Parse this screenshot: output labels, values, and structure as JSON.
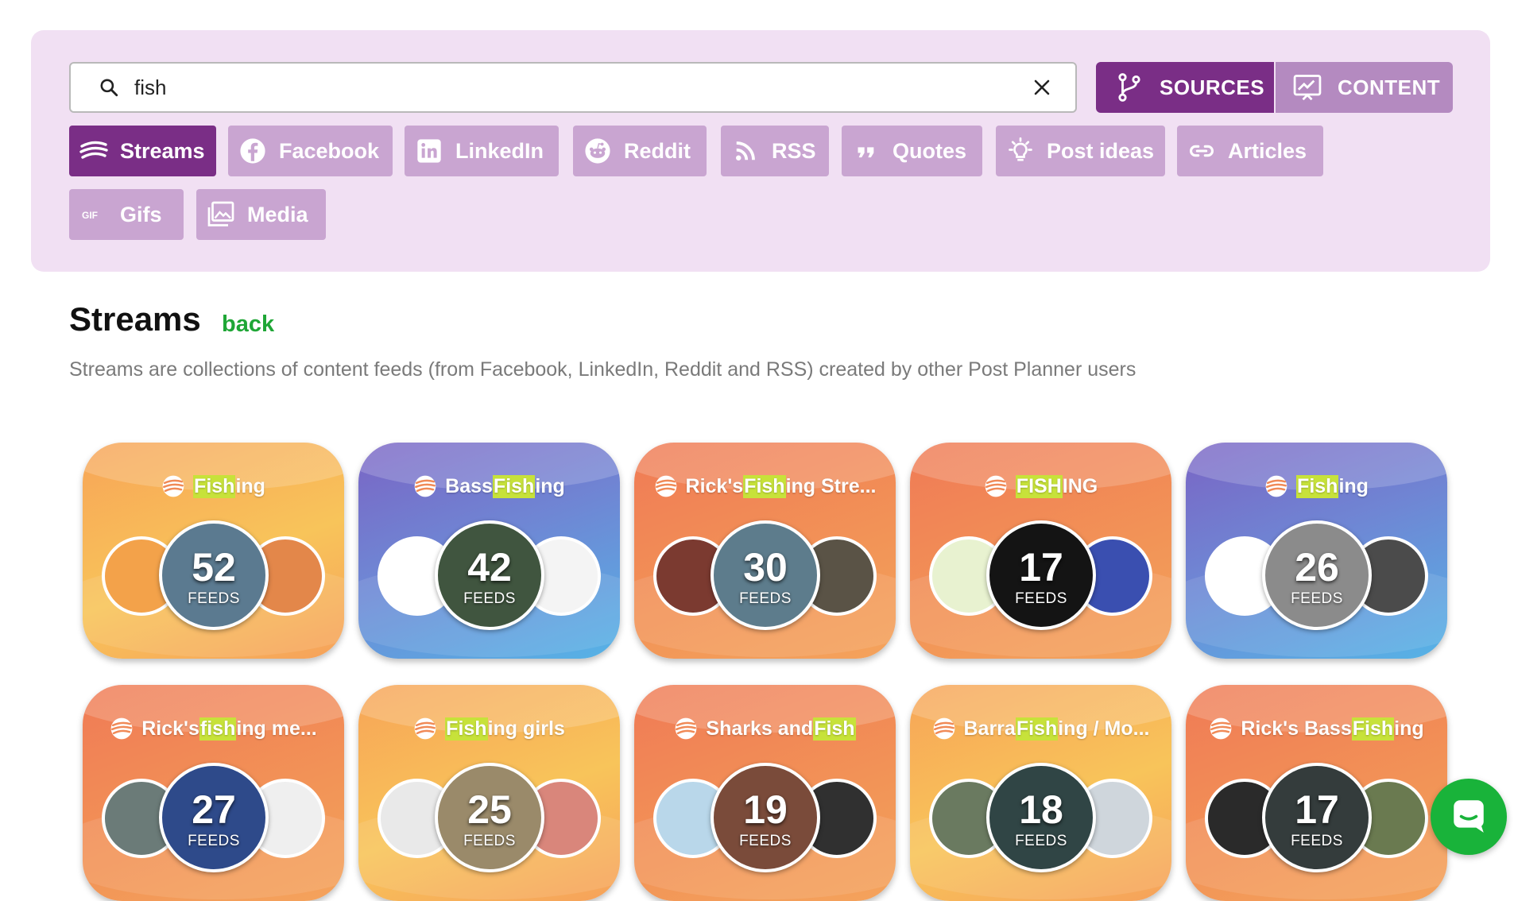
{
  "search": {
    "value": "fish",
    "clear_icon": "close-icon",
    "search_icon": "search-icon"
  },
  "modes": [
    {
      "label": "SOURCES",
      "icon": "source-branch-icon",
      "active": true
    },
    {
      "label": "CONTENT",
      "icon": "content-chart-icon",
      "active": false
    }
  ],
  "chips": [
    {
      "label": "Streams",
      "icon": "streams-icon",
      "active": true
    },
    {
      "label": "Facebook",
      "icon": "facebook-icon",
      "active": false
    },
    {
      "label": "LinkedIn",
      "icon": "linkedin-icon",
      "active": false
    },
    {
      "label": "Reddit",
      "icon": "reddit-icon",
      "active": false
    },
    {
      "label": "RSS",
      "icon": "rss-icon",
      "active": false
    },
    {
      "label": "Quotes",
      "icon": "quote-icon",
      "active": false
    },
    {
      "label": "Post ideas",
      "icon": "lightbulb-icon",
      "active": false
    },
    {
      "label": "Articles",
      "icon": "link-icon",
      "active": false
    },
    {
      "label": "Gifs",
      "icon": "gif-icon",
      "active": false
    },
    {
      "label": "Media",
      "icon": "image-icon",
      "active": false
    }
  ],
  "section": {
    "title": "Streams",
    "back_label": "back",
    "description": "Streams are collections of content feeds (from Facebook, LinkedIn, Reddit and RSS) created by other Post Planner users"
  },
  "colors": {
    "accent": "#7a2e86",
    "chip_inactive": "#c9a5d1",
    "panel_bg": "#f1e0f3",
    "back_green": "#1fa636",
    "highlight": "#c7e23a",
    "chat_green": "#19b33a"
  },
  "feeds_label": "FEEDS",
  "streams": [
    {
      "title_pre": "",
      "title_hl": "Fish",
      "title_post": "ing",
      "count": "52",
      "theme": "orange-yellow"
    },
    {
      "title_pre": "Bass ",
      "title_hl": "Fish",
      "title_post": "ing",
      "count": "42",
      "theme": "purple-blue"
    },
    {
      "title_pre": "Rick's ",
      "title_hl": "Fish",
      "title_post": "ing Stre...",
      "count": "30",
      "theme": "orange-red"
    },
    {
      "title_pre": "",
      "title_hl": "FISH",
      "title_post": "ING",
      "count": "17",
      "theme": "orange-red"
    },
    {
      "title_pre": "",
      "title_hl": "Fish",
      "title_post": "ing",
      "count": "26",
      "theme": "purple-blue"
    },
    {
      "title_pre": "Rick's ",
      "title_hl": "fish",
      "title_post": "ing me...",
      "count": "27",
      "theme": "orange-red"
    },
    {
      "title_pre": "",
      "title_hl": "Fish",
      "title_post": "ing girls",
      "count": "25",
      "theme": "orange-yellow"
    },
    {
      "title_pre": "Sharks and ",
      "title_hl": "Fish",
      "title_post": "",
      "count": "19",
      "theme": "orange-red"
    },
    {
      "title_pre": "Barra ",
      "title_hl": "Fish",
      "title_post": "ing / Mo...",
      "count": "18",
      "theme": "orange-yellow"
    },
    {
      "title_pre": "Rick's Bass ",
      "title_hl": "Fish",
      "title_post": "ing",
      "count": "17",
      "theme": "orange-red"
    }
  ],
  "chat_icon": "chat-icon"
}
